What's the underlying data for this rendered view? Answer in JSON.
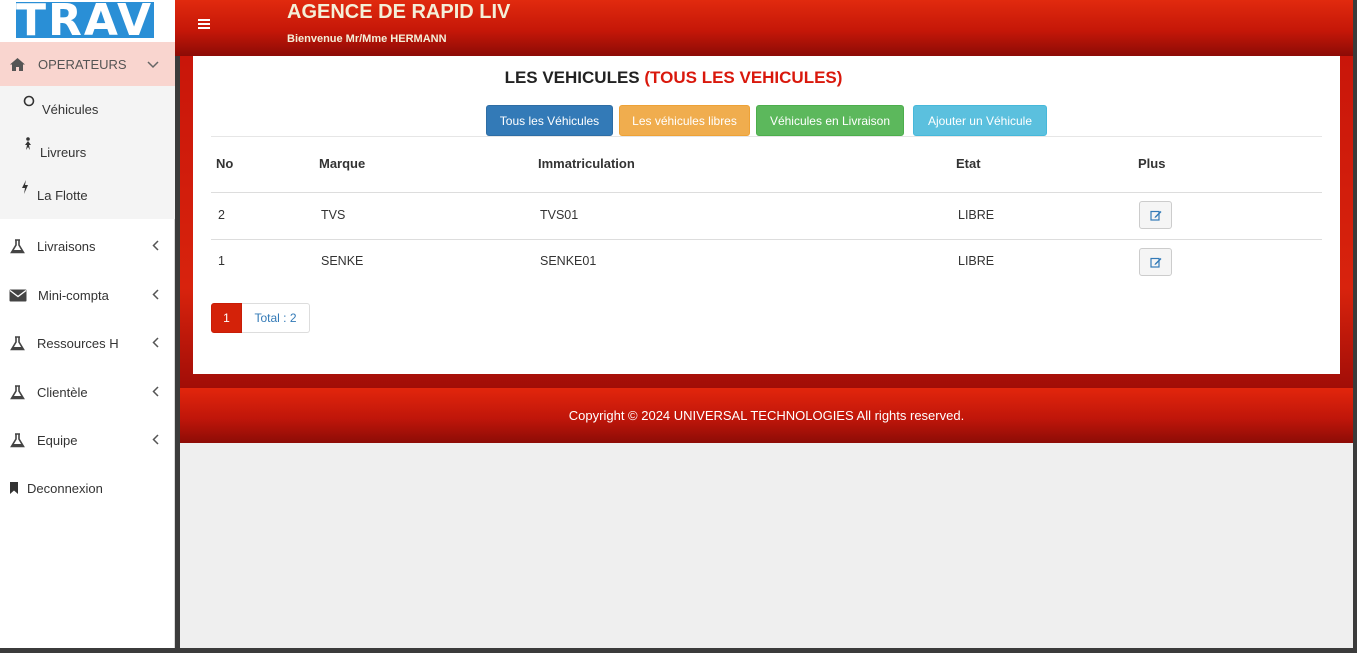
{
  "logo": {
    "text": "TRAV"
  },
  "sidebar": {
    "section": {
      "label": "OPERATEURS",
      "icon": "home-icon"
    },
    "sub_items": [
      {
        "label": "Véhicules",
        "icon": "circle-icon"
      },
      {
        "label": "Livreurs",
        "icon": "person-icon"
      },
      {
        "label": "La Flotte",
        "icon": "bolt-icon"
      }
    ],
    "items": [
      {
        "label": "Livraisons",
        "icon": "flask-icon"
      },
      {
        "label": "Mini-compta",
        "icon": "envelope-icon"
      },
      {
        "label": "Ressources H",
        "icon": "flask-icon"
      },
      {
        "label": "Clientèle",
        "icon": "flask-icon"
      },
      {
        "label": "Equipe",
        "icon": "flask-icon"
      }
    ],
    "logout": {
      "label": "Deconnexion",
      "icon": "bookmark-icon"
    }
  },
  "header": {
    "title": "AGENCE DE RAPID LIV",
    "welcome": "Bienvenue Mr/Mme HERMANN",
    "menu_icon": "hamburger-icon"
  },
  "page": {
    "title": "LES VEHICULES",
    "subtitle": "(TOUS LES VEHICULES)"
  },
  "buttons": {
    "all": "Tous les Véhicules",
    "free": "Les véhicules libres",
    "delivering": "Véhicules en Livraison",
    "add": "Ajouter un Véhicule"
  },
  "table": {
    "headers": [
      "No",
      "Marque",
      "Immatriculation",
      "Etat",
      "Plus"
    ],
    "rows": [
      {
        "no": "2",
        "marque": "TVS",
        "immatriculation": "TVS01",
        "etat": "LIBRE"
      },
      {
        "no": "1",
        "marque": "SENKE",
        "immatriculation": "SENKE01",
        "etat": "LIBRE"
      }
    ]
  },
  "pagination": {
    "current": "1",
    "total": "Total : 2"
  },
  "footer": {
    "text": "Copyright © 2024 UNIVERSAL TECHNOLOGIES All rights reserved."
  },
  "colors": {
    "accent": "#d9180c",
    "header_red": "#c51708",
    "primary": "#337ab7",
    "warning": "#f0ad4e",
    "success": "#5cb85c",
    "info": "#5bc0de"
  }
}
